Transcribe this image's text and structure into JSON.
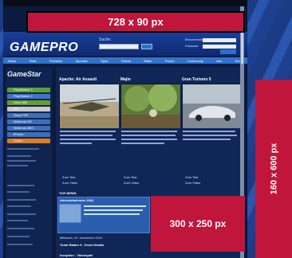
{
  "ads": {
    "leaderboard": "728 x 90 px",
    "rectangle": "300 x 250 px",
    "skyscraper": "160 x 600 px"
  },
  "header": {
    "logo": "GAMEPRO",
    "search_label": "Suche:",
    "login_user_label": "Benutzername",
    "login_pass_label": "Passwort"
  },
  "nav": [
    "News",
    "Tests",
    "Previews",
    "Specials",
    "Tipps",
    "Videos",
    "Bilder",
    "Forum",
    "Community",
    "Abo",
    "Shop"
  ],
  "sidebar": {
    "logo": "GameStar",
    "items": [
      {
        "label": "PlayStation 3",
        "color": "#5f9d3a"
      },
      {
        "label": "PlayStation 2",
        "color": "#3c76c7"
      },
      {
        "label": "Xbox 360",
        "color": "#6a9c2c"
      },
      {
        "label": "Wii",
        "color": "#c9c9c9"
      },
      {
        "label": "Sony PSP",
        "color": "#3f6fb7"
      },
      {
        "label": "Nintendo DS",
        "color": "#3f6fb7"
      },
      {
        "label": "Nintendo 3DS",
        "color": "#3f6fb7"
      },
      {
        "label": "iPhone",
        "color": "#3f6fb7"
      },
      {
        "label": "Online",
        "color": "#e07a1e"
      }
    ]
  },
  "cards": [
    {
      "title": "Apache: Air Assault",
      "link1": "Zum Test",
      "link2": "Zum Video"
    },
    {
      "title": "Majin",
      "link1": "Zum Test",
      "link2": "Zum Video"
    },
    {
      "title": "Gran Turismo 5",
      "link1": "Zum Test",
      "link2": "Zum Video"
    }
  ],
  "sections": {
    "top_news": "TOP-NEWS",
    "advent": "Adventskalender 2010",
    "date": "Mittwoch, 01. Dezember 2010",
    "tomb": "Tomb Raider 9 - Erste Details",
    "inception": "Inception - Videospiel"
  }
}
